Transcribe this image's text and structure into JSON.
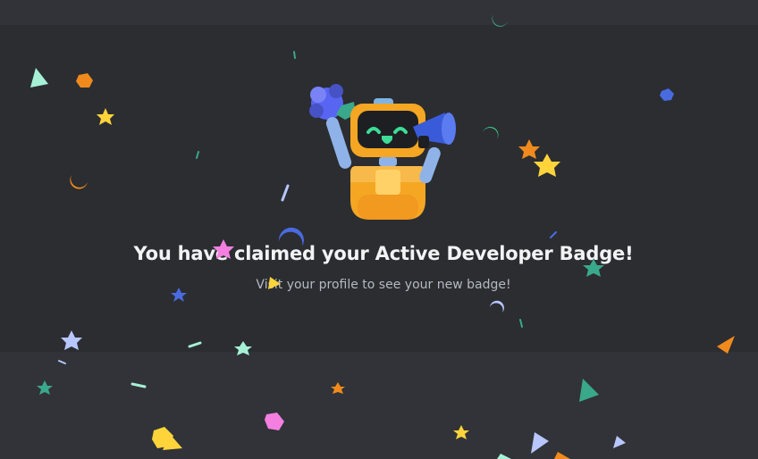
{
  "claim": {
    "headline": "You have claimed your Active Developer Badge!",
    "subtext": "Visit your profile to see your new badge!"
  },
  "colors": {
    "background": "#313338",
    "panel": "#2b2d31",
    "headline": "#f2f3f5",
    "subtext": "#b5bac1",
    "mascot_body": "#f5a623",
    "mascot_face": "#1e1f22",
    "mascot_eyes": "#3ddc97",
    "megaphone": "#3a5bd9",
    "pompom": "#5865f2"
  },
  "decorations": {
    "mascot_icon": "cheering-robot-icon",
    "confetti_icon": "confetti-icon"
  }
}
